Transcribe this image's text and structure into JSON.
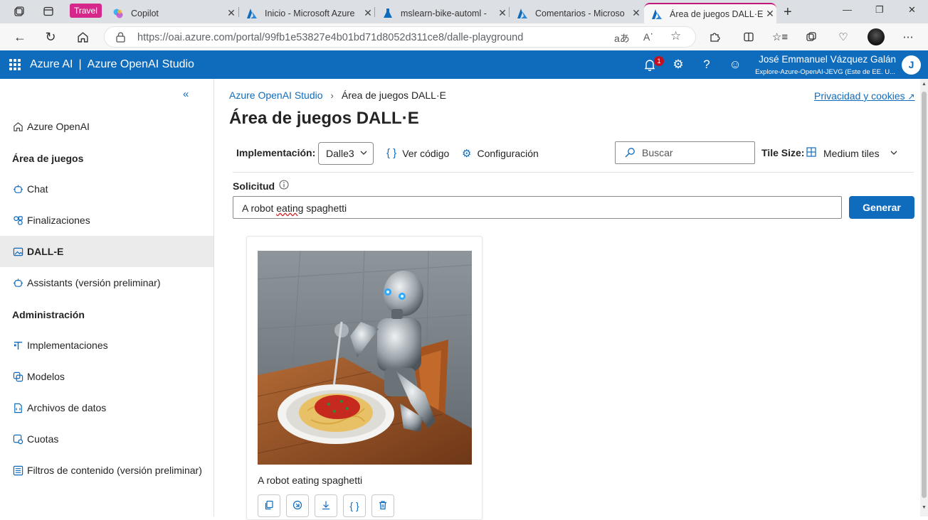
{
  "browser": {
    "workspace": "Travel",
    "tabs": [
      {
        "title": "Copilot"
      },
      {
        "title": "Inicio - Microsoft Azure"
      },
      {
        "title": "mslearn-bike-automl -"
      },
      {
        "title": "Comentarios - Microso"
      },
      {
        "title": "Área de juegos DALL·E"
      }
    ],
    "url": "https://oai.azure.com/portal/99fb1e53827e4b01bd71d8052d311ce8/dalle-playground"
  },
  "header": {
    "brand": "Azure AI",
    "separator": "|",
    "studio": "Azure OpenAI Studio",
    "notification_count": "1",
    "user_name": "José Emmanuel Vázquez Galán",
    "user_directory": "Explore-Azure-OpenAI-JEVG (Este de EE. U...",
    "user_initial": "J"
  },
  "sidebar": {
    "items": [
      {
        "label": "Azure OpenAI"
      },
      {
        "label": "Chat"
      },
      {
        "label": "Finalizaciones"
      },
      {
        "label": "DALL-E"
      },
      {
        "label": "Assistants (versión preliminar)"
      },
      {
        "label": "Implementaciones"
      },
      {
        "label": "Modelos"
      },
      {
        "label": "Archivos de datos"
      },
      {
        "label": "Cuotas"
      },
      {
        "label": "Filtros de contenido (versión preliminar)"
      }
    ],
    "groups": [
      "Área de juegos",
      "Administración"
    ]
  },
  "main": {
    "breadcrumb": [
      "Azure OpenAI Studio",
      "Área de juegos DALL·E"
    ],
    "privacy_link": "Privacidad y cookies",
    "title": "Área de juegos DALL·E",
    "deployment_label": "Implementación:",
    "deployment_value": "Dalle3",
    "view_code": "Ver código",
    "configuration": "Configuración",
    "search_placeholder": "Buscar",
    "tile_size_label": "Tile Size:",
    "tile_size_value": "Medium tiles",
    "prompt_label": "Solicitud",
    "prompt_prefix": "A robot ",
    "prompt_spell": "eating",
    "prompt_suffix": " spaghetti",
    "generate_button": "Generar",
    "result": {
      "caption": "A robot eating spaghetti"
    }
  },
  "colors": {
    "accent": "#0f6cbd",
    "workspace": "#d6288a"
  }
}
